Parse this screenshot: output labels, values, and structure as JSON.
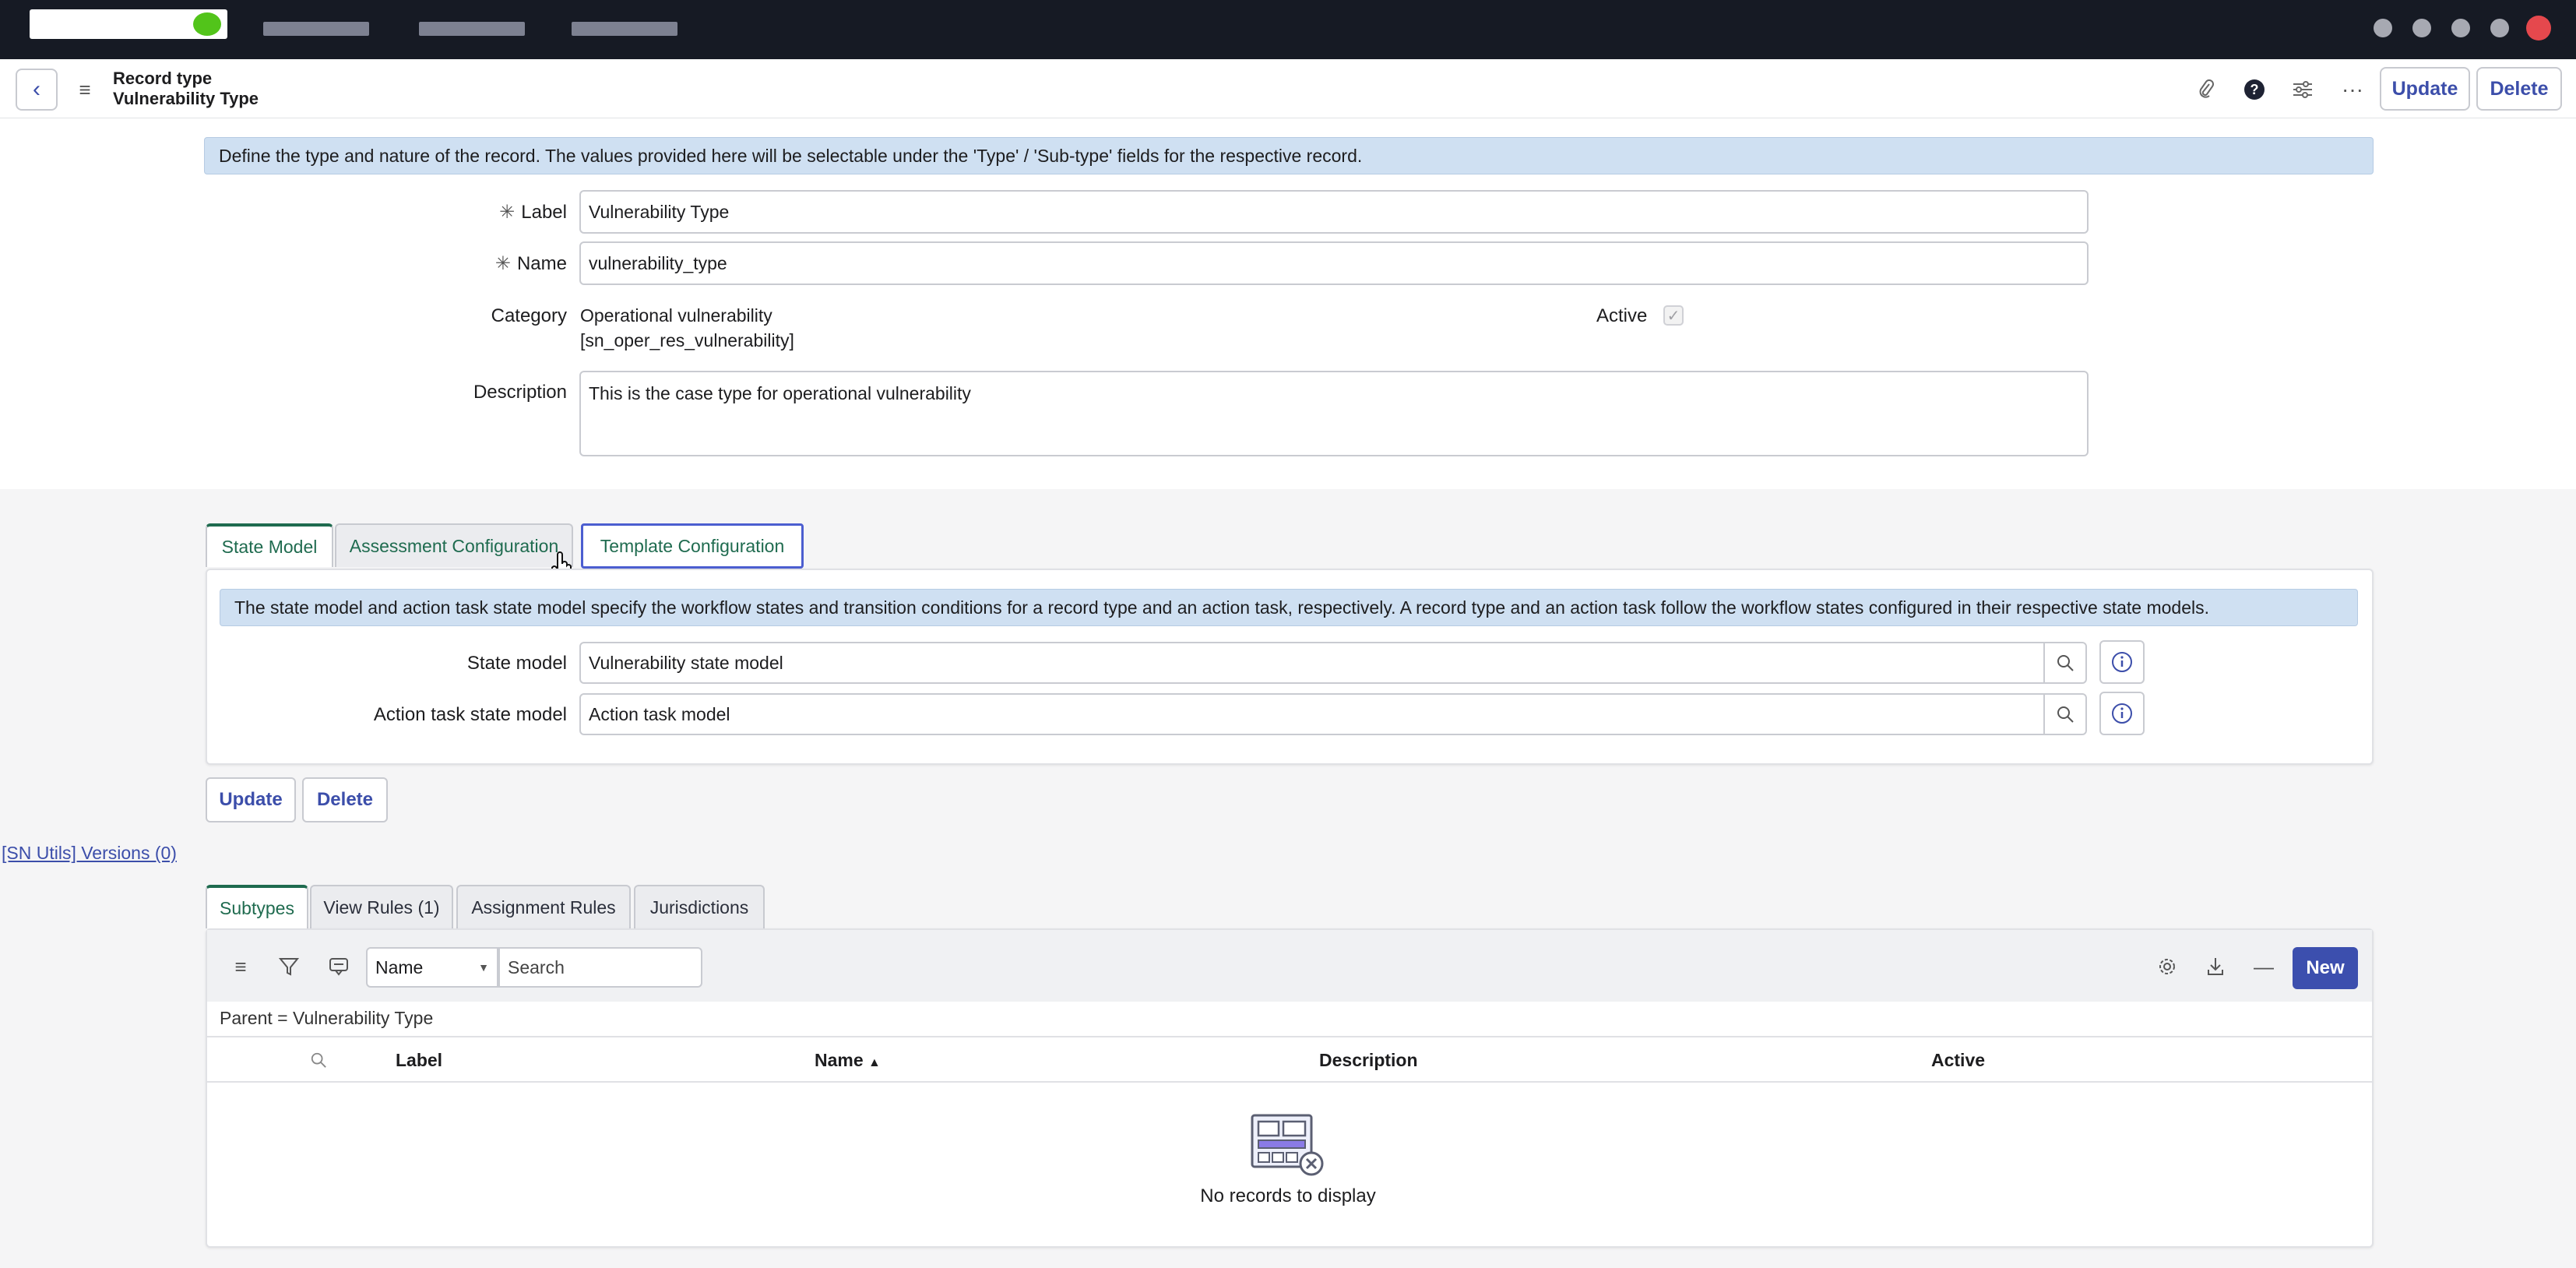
{
  "header": {
    "title_line1": "Record type",
    "title_line2": "Vulnerability Type",
    "update_label": "Update",
    "delete_label": "Delete"
  },
  "form": {
    "banner": "Define the type and nature of the record. The values provided here will be selectable under the 'Type' / 'Sub-type' fields for the respective record.",
    "label_label": "Label",
    "label_value": "Vulnerability Type",
    "name_label": "Name",
    "name_value": "vulnerability_type",
    "category_label": "Category",
    "category_line1": "Operational vulnerability",
    "category_line2": "[sn_oper_res_vulnerability]",
    "active_label": "Active",
    "active_checked": true,
    "description_label": "Description",
    "description_value": "This is the case type for operational vulnerability"
  },
  "section_tabs": [
    {
      "label": "State Model"
    },
    {
      "label": "Assessment Configuration"
    },
    {
      "label": "Template Configuration"
    }
  ],
  "state_panel": {
    "banner": "The state model and action task state model specify the workflow states and transition conditions for a record type and an action task, respectively. A record type and an action task follow the workflow states configured in their respective state models.",
    "state_model_label": "State model",
    "state_model_value": "Vulnerability state model",
    "action_label": "Action task state model",
    "action_value": "Action task model"
  },
  "bottom_buttons": {
    "update_label": "Update",
    "delete_label": "Delete"
  },
  "sn_utils_link": "[SN Utils] Versions (0)",
  "related_tabs": [
    {
      "label": "Subtypes"
    },
    {
      "label": "View Rules (1)"
    },
    {
      "label": "Assignment Rules"
    },
    {
      "label": "Jurisdictions"
    }
  ],
  "list": {
    "field_select": "Name",
    "search_placeholder": "Search",
    "new_label": "New",
    "filter_text": "Parent = Vulnerability Type",
    "columns": [
      "Label",
      "Name",
      "Description",
      "Active"
    ],
    "empty_text": "No records to display"
  },
  "colors": {
    "accent": "#3c4fae",
    "active_tab": "#1f6b4f",
    "banner_bg": "#cfe0f2"
  }
}
